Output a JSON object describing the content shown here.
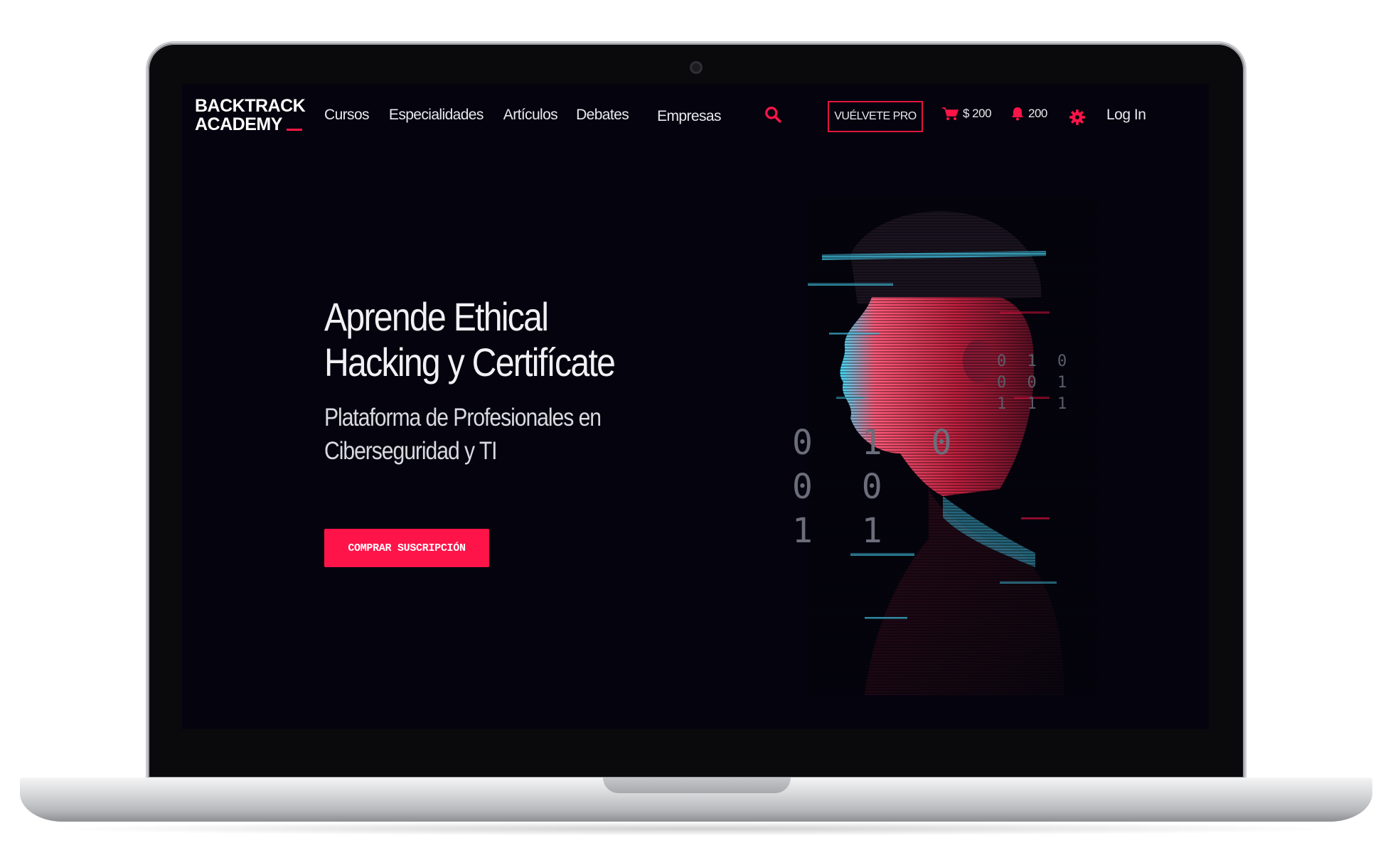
{
  "logo": {
    "line1": "BACKTRACK",
    "line2": "ACADEMY"
  },
  "nav": {
    "items": [
      {
        "label": "Cursos"
      },
      {
        "label": "Especialidades"
      },
      {
        "label": "Artículos"
      },
      {
        "label": "Debates"
      },
      {
        "label": "Empresas"
      }
    ],
    "pro_label": "VUÉLVETE PRO",
    "cart_value": "$ 200",
    "notifications_count": "200",
    "login_label": "Log In"
  },
  "hero": {
    "title_line1": "Aprende Ethical",
    "title_line2": "Hacking y Certifícate",
    "subtitle_line1": "Plataforma de Profesionales en",
    "subtitle_line2": "Ciberseguridad y TI",
    "cta_label": "COMPRAR SUSCRIPCIÓN"
  },
  "binary_large": [
    "0 1 0",
    "0 0",
    "1 1"
  ],
  "binary_small": [
    "0 1 0",
    "0 0 1",
    "1 1 1"
  ],
  "colors": {
    "accent": "#ff1449",
    "background": "#05040e",
    "text": "#e8e8ee"
  },
  "icons": {
    "search": "search-icon",
    "cart": "cart-icon",
    "bell": "bell-icon",
    "gear": "gear-icon"
  }
}
